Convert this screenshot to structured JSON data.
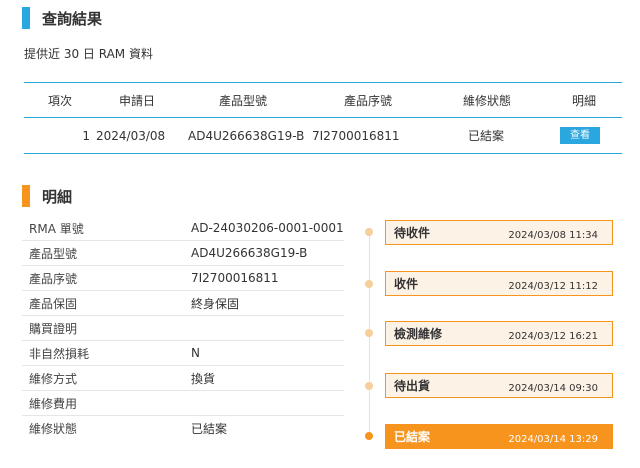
{
  "colors": {
    "accent_blue": "#2aa7df",
    "accent_orange": "#f7941d",
    "step_bg": "#fdf2e6"
  },
  "result_section": {
    "title": "查詢結果",
    "subtitle": "提供近 30 日 RAM 資料",
    "columns": [
      "項次",
      "申請日",
      "產品型號",
      "產品序號",
      "維修狀態",
      "明細"
    ],
    "rows": [
      {
        "index": "1",
        "date": "2024/03/08",
        "model": "AD4U266638G19-B",
        "serial": "7I2700016811",
        "status": "已結案",
        "action": "查看"
      }
    ]
  },
  "detail_section": {
    "title": "明細",
    "fields": [
      {
        "label": "RMA 單號",
        "value": "AD-24030206-0001-0001"
      },
      {
        "label": "產品型號",
        "value": "AD4U266638G19-B"
      },
      {
        "label": "產品序號",
        "value": "7I2700016811"
      },
      {
        "label": "產品保固",
        "value": "終身保固"
      },
      {
        "label": "購買證明",
        "value": ""
      },
      {
        "label": "非自然損耗",
        "value": "N"
      },
      {
        "label": "維修方式",
        "value": "換貨"
      },
      {
        "label": "維修費用",
        "value": ""
      },
      {
        "label": "維修狀態",
        "value": "已結案"
      }
    ]
  },
  "timeline": [
    {
      "name": "待收件",
      "time": "2024/03/08 11:34",
      "active": false
    },
    {
      "name": "收件",
      "time": "2024/03/12 11:12",
      "active": false
    },
    {
      "name": "檢測維修",
      "time": "2024/03/12 16:21",
      "active": false
    },
    {
      "name": "待出貨",
      "time": "2024/03/14 09:30",
      "active": false
    },
    {
      "name": "已結案",
      "time": "2024/03/14 13:29",
      "active": true
    }
  ]
}
